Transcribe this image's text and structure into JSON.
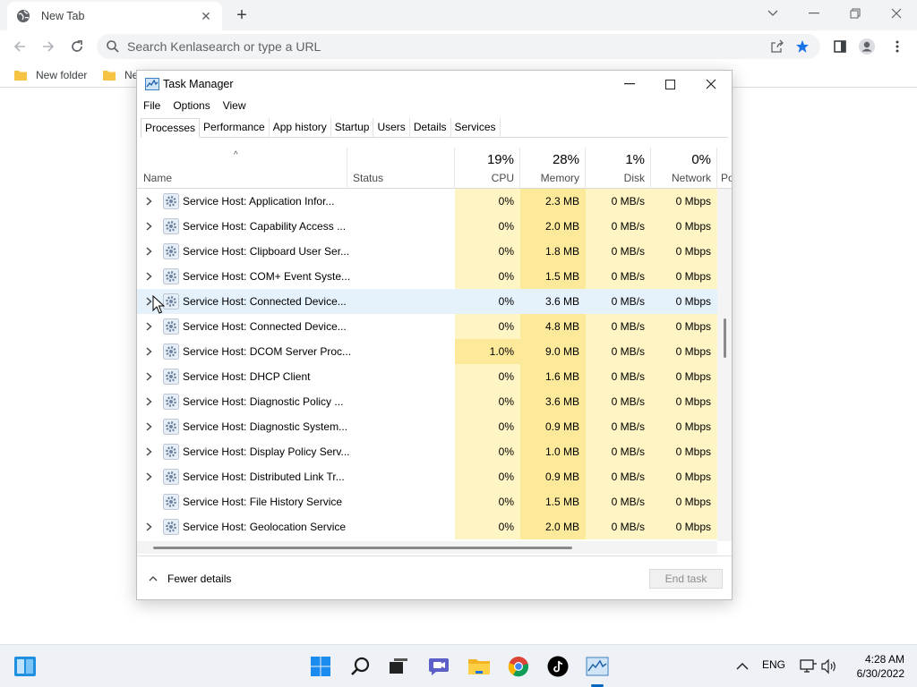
{
  "browser": {
    "tab_title": "New Tab",
    "omnibox_placeholder": "Search Kenlasearch or type a URL",
    "bookmarks": [
      "New folder",
      "Ne"
    ]
  },
  "task_manager": {
    "title": "Task Manager",
    "menu": [
      "File",
      "Options",
      "View"
    ],
    "tabs": [
      "Processes",
      "Performance",
      "App history",
      "Startup",
      "Users",
      "Details",
      "Services"
    ],
    "active_tab": "Processes",
    "columns": {
      "name": "Name",
      "status": "Status",
      "cpu": {
        "label": "CPU",
        "pct": "19%"
      },
      "memory": {
        "label": "Memory",
        "pct": "28%"
      },
      "disk": {
        "label": "Disk",
        "pct": "1%"
      },
      "network": {
        "label": "Network",
        "pct": "0%"
      },
      "power_partial": "Po"
    },
    "processes": [
      {
        "name": "Service Host: Application Infor...",
        "expandable": true,
        "cpu": "0%",
        "memory": "2.3 MB",
        "disk": "0 MB/s",
        "network": "0 Mbps"
      },
      {
        "name": "Service Host: Capability Access ...",
        "expandable": true,
        "cpu": "0%",
        "memory": "2.0 MB",
        "disk": "0 MB/s",
        "network": "0 Mbps"
      },
      {
        "name": "Service Host: Clipboard User Ser...",
        "expandable": true,
        "cpu": "0%",
        "memory": "1.8 MB",
        "disk": "0 MB/s",
        "network": "0 Mbps"
      },
      {
        "name": "Service Host: COM+ Event Syste...",
        "expandable": true,
        "cpu": "0%",
        "memory": "1.5 MB",
        "disk": "0 MB/s",
        "network": "0 Mbps"
      },
      {
        "name": "Service Host: Connected Device...",
        "expandable": true,
        "cpu": "0%",
        "memory": "3.6 MB",
        "disk": "0 MB/s",
        "network": "0 Mbps",
        "hover": true
      },
      {
        "name": "Service Host: Connected Device...",
        "expandable": true,
        "cpu": "0%",
        "memory": "4.8 MB",
        "disk": "0 MB/s",
        "network": "0 Mbps"
      },
      {
        "name": "Service Host: DCOM Server Proc...",
        "expandable": true,
        "cpu": "1.0%",
        "memory": "9.0 MB",
        "disk": "0 MB/s",
        "network": "0 Mbps",
        "cpu_high": true
      },
      {
        "name": "Service Host: DHCP Client",
        "expandable": true,
        "cpu": "0%",
        "memory": "1.6 MB",
        "disk": "0 MB/s",
        "network": "0 Mbps"
      },
      {
        "name": "Service Host: Diagnostic Policy ...",
        "expandable": true,
        "cpu": "0%",
        "memory": "3.6 MB",
        "disk": "0 MB/s",
        "network": "0 Mbps"
      },
      {
        "name": "Service Host: Diagnostic System...",
        "expandable": true,
        "cpu": "0%",
        "memory": "0.9 MB",
        "disk": "0 MB/s",
        "network": "0 Mbps"
      },
      {
        "name": "Service Host: Display Policy Serv...",
        "expandable": true,
        "cpu": "0%",
        "memory": "1.0 MB",
        "disk": "0 MB/s",
        "network": "0 Mbps"
      },
      {
        "name": "Service Host: Distributed Link Tr...",
        "expandable": true,
        "cpu": "0%",
        "memory": "0.9 MB",
        "disk": "0 MB/s",
        "network": "0 Mbps"
      },
      {
        "name": "Service Host: File History Service",
        "expandable": false,
        "cpu": "0%",
        "memory": "1.5 MB",
        "disk": "0 MB/s",
        "network": "0 Mbps"
      },
      {
        "name": "Service Host: Geolocation Service",
        "expandable": true,
        "cpu": "0%",
        "memory": "2.0 MB",
        "disk": "0 MB/s",
        "network": "0 Mbps"
      }
    ],
    "footer": {
      "fewer_details": "Fewer details",
      "end_task": "End task"
    }
  },
  "taskbar": {
    "language": "ENG",
    "time": "4:28 AM",
    "date": "6/30/2022"
  },
  "colors": {
    "cell_light": "#fff4c4",
    "cell_medium": "#fde99a",
    "row_hover": "#e5f1fb",
    "accent": "#0067c0"
  }
}
